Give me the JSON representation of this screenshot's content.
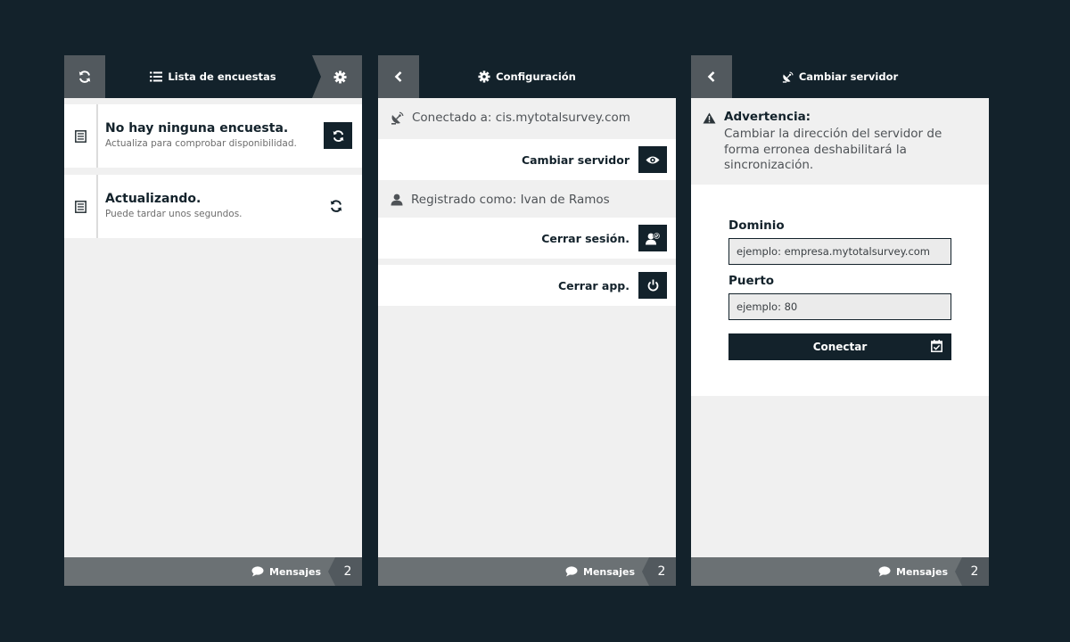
{
  "colors": {
    "dark": "#13222b",
    "header_btn": "#52595e",
    "footer": "#6b7174",
    "panel_bg": "#f0f0f0"
  },
  "panels": [
    {
      "header": {
        "left_icon": "refresh-icon",
        "title_icon": "list-icon",
        "title": "Lista de encuestas",
        "right_icon": "gear-icon"
      },
      "cards": [
        {
          "icon": "document-icon",
          "title": "No hay ninguna encuesta.",
          "subtitle": "Actualiza para comprobar disponibilidad.",
          "action_icon": "refresh-icon"
        },
        {
          "icon": "document-icon",
          "title": "Actualizando.",
          "subtitle": "Puede tardar unos segundos.",
          "action_icon": "sync-icon"
        }
      ],
      "footer": {
        "icon": "speech-bubble-icon",
        "label": "Mensajes",
        "count": "2"
      }
    },
    {
      "header": {
        "left_icon": "chevron-left-icon",
        "title_icon": "gear-icon",
        "title": "Configuración"
      },
      "server": {
        "icon": "satellite-dish-icon",
        "text": "Conectado a: cis.mytotalsurvey.com"
      },
      "change_server": {
        "label": "Cambiar servidor",
        "icon": "eye-icon"
      },
      "user": {
        "icon": "user-icon",
        "text": "Registrado como: Ivan de Ramos"
      },
      "logout": {
        "label": "Cerrar sesión.",
        "icon": "user-logout-icon"
      },
      "close_app": {
        "label": "Cerrar app.",
        "icon": "power-icon"
      },
      "footer": {
        "icon": "speech-bubble-icon",
        "label": "Mensajes",
        "count": "2"
      }
    },
    {
      "header": {
        "left_icon": "chevron-left-icon",
        "title_icon": "satellite-dish-icon",
        "title": "Cambiar servidor"
      },
      "warning": {
        "icon": "warning-icon",
        "title": "Advertencia:",
        "text": "Cambiar la dirección del servidor de forma erronea deshabilitará la sincronización."
      },
      "form": {
        "domain_label": "Dominio",
        "domain_placeholder": "ejemplo: empresa.mytotalsurvey.com",
        "port_label": "Puerto",
        "port_placeholder": "ejemplo: 80",
        "submit_label": "Conectar",
        "submit_icon": "calendar-check-icon"
      },
      "footer": {
        "icon": "speech-bubble-icon",
        "label": "Mensajes",
        "count": "2"
      }
    }
  ]
}
